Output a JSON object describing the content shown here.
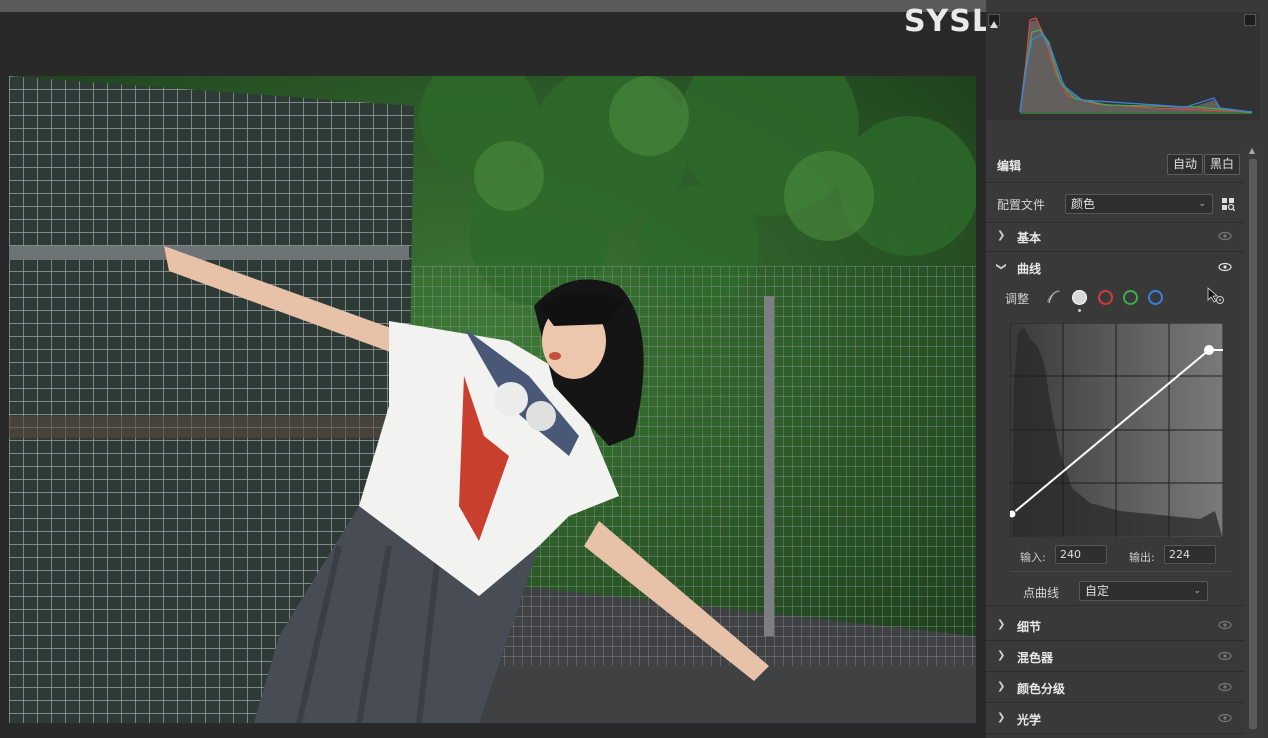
{
  "watermark": "SYSL",
  "panel": {
    "edit": {
      "title": "编辑",
      "auto_label": "自动",
      "bw_label": "黑白"
    },
    "profile": {
      "label": "配置文件",
      "value": "颜色"
    },
    "sections": {
      "basic": "基本",
      "curve": "曲线",
      "detail": "细节",
      "mixer": "混色器",
      "color_grading": "颜色分级",
      "optics": "光学"
    },
    "curve": {
      "adjust_label": "调整",
      "channels": [
        "parametric-curve",
        "point-curve-white",
        "red",
        "green",
        "blue"
      ],
      "input_label": "输入:",
      "input_value": "240",
      "output_label": "输出:",
      "output_value": "224",
      "point_curve_label": "点曲线",
      "point_curve_value": "自定"
    }
  },
  "colors": {
    "panel_bg": "#393939",
    "red_channel": "#d33a3a",
    "green_channel": "#3fae49",
    "blue_channel": "#3d7fe0"
  }
}
